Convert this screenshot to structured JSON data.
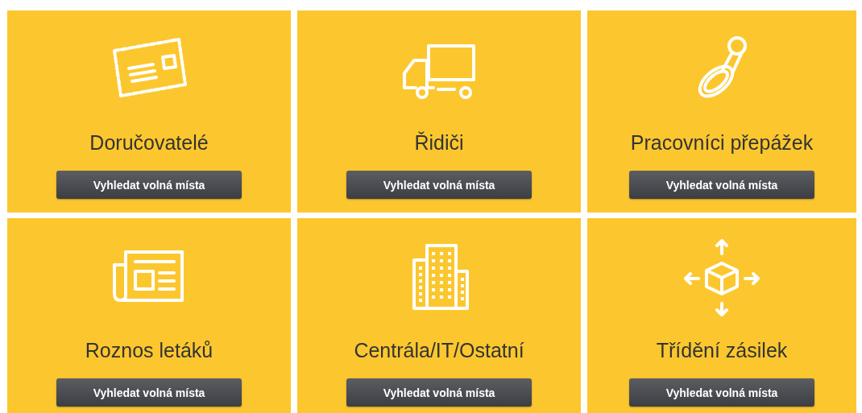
{
  "tiles": [
    {
      "kind": "postcard",
      "title": "Doručovatelé",
      "button": "Vyhledat volná místa"
    },
    {
      "kind": "truck",
      "title": "Řidiči",
      "button": "Vyhledat volná místa"
    },
    {
      "kind": "stamp",
      "title": "Pracovníci přepážek",
      "button": "Vyhledat volná místa"
    },
    {
      "kind": "newspaper",
      "title": "Roznos letáků",
      "button": "Vyhledat volná místa"
    },
    {
      "kind": "building",
      "title": "Centrála/IT/Ostatní",
      "button": "Vyhledat volná místa"
    },
    {
      "kind": "box",
      "title": "Třídění zásilek",
      "button": "Vyhledat volná místa"
    }
  ]
}
